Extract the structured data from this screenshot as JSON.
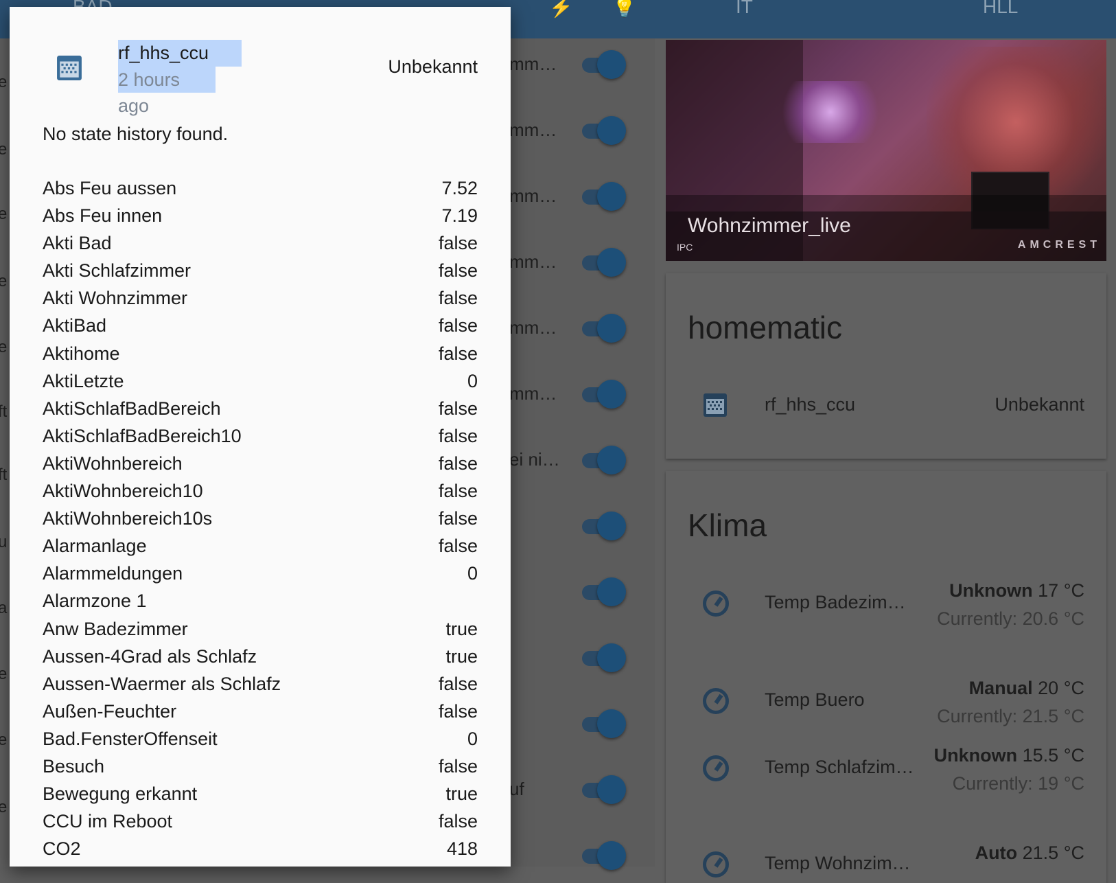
{
  "toolbar": {
    "items": [
      "BAD",
      "IT",
      "HLL"
    ]
  },
  "background_list": {
    "rows": [
      "mm…",
      "mm…",
      "mm…",
      "mm…",
      "mm…",
      "mm…",
      "ei ni…",
      "",
      "",
      "",
      "",
      "uf",
      ""
    ]
  },
  "camera": {
    "title": "Wohnzimmer_live",
    "ipc_label": "IPC",
    "brand": "AMCREST"
  },
  "homematic_card": {
    "title": "homematic",
    "entity": {
      "name": "rf_hhs_ccu",
      "state": "Unbekannt"
    }
  },
  "klima_card": {
    "title": "Klima",
    "entities": [
      {
        "name": "Temp Badezim…",
        "mode": "Unknown",
        "target": "17 °C",
        "current": "Currently: 20.6 °C"
      },
      {
        "name": "Temp Buero",
        "mode": "Manual",
        "target": "20 °C",
        "current": "Currently: 21.5 °C"
      },
      {
        "name": "Temp Schlafzim…",
        "mode": "Unknown",
        "target": "15.5 °C",
        "current": "Currently: 19 °C"
      },
      {
        "name": "Temp Wohnzim…",
        "mode": "Auto",
        "target": "21.5 °C",
        "current": ""
      }
    ]
  },
  "dialog": {
    "entity_name": "rf_hhs_ccu",
    "last_changed": "2 hours ago",
    "state": "Unbekannt",
    "no_history": "No state history found.",
    "attributes": [
      {
        "key": "Abs Feu aussen",
        "value": "7.52"
      },
      {
        "key": "Abs Feu innen",
        "value": "7.19"
      },
      {
        "key": "Akti Bad",
        "value": "false"
      },
      {
        "key": "Akti Schlafzimmer",
        "value": "false"
      },
      {
        "key": "Akti Wohnzimmer",
        "value": "false"
      },
      {
        "key": "AktiBad",
        "value": "false"
      },
      {
        "key": "Aktihome",
        "value": "false"
      },
      {
        "key": "AktiLetzte",
        "value": "0"
      },
      {
        "key": "AktiSchlafBadBereich",
        "value": "false"
      },
      {
        "key": "AktiSchlafBadBereich10",
        "value": "false"
      },
      {
        "key": "AktiWohnbereich",
        "value": "false"
      },
      {
        "key": "AktiWohnbereich10",
        "value": "false"
      },
      {
        "key": "AktiWohnbereich10s",
        "value": "false"
      },
      {
        "key": "Alarmanlage",
        "value": "false"
      },
      {
        "key": "Alarmmeldungen",
        "value": "0"
      },
      {
        "key": "Alarmzone 1",
        "value": ""
      },
      {
        "key": "Anw Badezimmer",
        "value": "true"
      },
      {
        "key": "Aussen-4Grad als Schlafz",
        "value": "true"
      },
      {
        "key": "Aussen-Waermer als Schlafz",
        "value": "false"
      },
      {
        "key": "Außen-Feuchter",
        "value": "false"
      },
      {
        "key": "Bad.FensterOffenseit",
        "value": "0"
      },
      {
        "key": "Besuch",
        "value": "false"
      },
      {
        "key": "Bewegung erkannt",
        "value": "true"
      },
      {
        "key": "CCU im Reboot",
        "value": "false"
      },
      {
        "key": "CO2",
        "value": "418"
      }
    ]
  },
  "colors": {
    "toolbar": "#2a4f70",
    "toggle_on": "#1d4f78",
    "selection": "#bcd6fb",
    "icon": "#26415a"
  }
}
